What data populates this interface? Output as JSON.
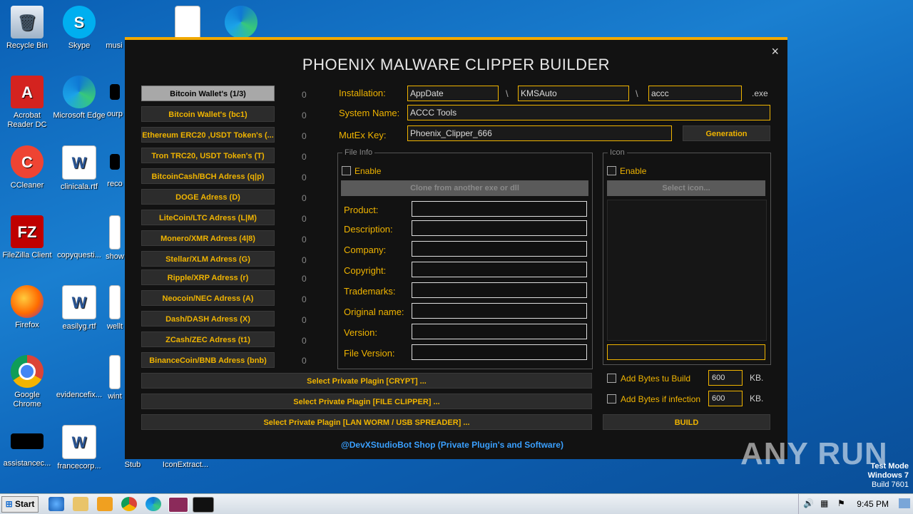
{
  "desktop": {
    "icons": [
      {
        "label": "Recycle Bin",
        "icon": "recycle-bin-icon"
      },
      {
        "label": "Skype",
        "icon": "skype-icon"
      },
      {
        "label": "musi",
        "icon": "blank-icon"
      },
      {
        "label": "Acrobat Reader DC",
        "icon": "acrobat-icon"
      },
      {
        "label": "Microsoft Edge",
        "icon": "edge-icon"
      },
      {
        "label": "ourp",
        "icon": "blank-icon"
      },
      {
        "label": "CCleaner",
        "icon": "ccleaner-icon"
      },
      {
        "label": "clinicala.rtf",
        "icon": "word-doc-icon"
      },
      {
        "label": "reco",
        "icon": "blank-icon"
      },
      {
        "label": "FileZilla Client",
        "icon": "filezilla-icon"
      },
      {
        "label": "copyquesti...",
        "icon": "blank-icon"
      },
      {
        "label": "show",
        "icon": "word-doc-icon"
      },
      {
        "label": "Firefox",
        "icon": "firefox-icon"
      },
      {
        "label": "easilyg.rtf",
        "icon": "word-doc-icon"
      },
      {
        "label": "wellt",
        "icon": "word-doc-icon"
      },
      {
        "label": "Google Chrome",
        "icon": "chrome-icon"
      },
      {
        "label": "evidencefix...",
        "icon": "blank-icon"
      },
      {
        "label": "wint",
        "icon": "word-doc-icon"
      },
      {
        "label": "assistancec...",
        "icon": "black-icon"
      },
      {
        "label": "francecorp...",
        "icon": "word-doc-icon"
      },
      {
        "label": "Stub",
        "icon": "stub-icon"
      },
      {
        "label": "IconExtract...",
        "icon": "blank-icon"
      }
    ],
    "watermark": "ANY RUN",
    "test_mode": {
      "line1": "Test Mode",
      "line2": "Windows 7",
      "line3": "Build 7601"
    }
  },
  "window": {
    "title": "PHOENIX MALWARE CLIPPER BUILDER",
    "close": "×",
    "wallets": [
      {
        "label": "Bitcoin Wallet's (1/3)",
        "count": "0"
      },
      {
        "label": "Bitcoin Wallet's (bc1)",
        "count": "0"
      },
      {
        "label": "Ethereum ERC20 ,USDT Token's (...",
        "count": "0"
      },
      {
        "label": "Tron TRC20, USDT Token's (T)",
        "count": "0"
      },
      {
        "label": "BitcoinCash/BCH Adress (q|p)",
        "count": "0"
      },
      {
        "label": "DOGE Adress (D)",
        "count": "0"
      },
      {
        "label": "LiteCoin/LTC Adress (L|M)",
        "count": "0"
      },
      {
        "label": "Monero/XMR Adress (4|8)",
        "count": "0"
      },
      {
        "label": "Stellar/XLM Adress (G)",
        "count": "0"
      },
      {
        "label": "Ripple/XRP Adress (r)",
        "count": "0"
      },
      {
        "label": "Neocoin/NEC Adress (A)",
        "count": "0"
      },
      {
        "label": "Dash/DASH Adress (X)",
        "count": "0"
      },
      {
        "label": "ZCash/ZEC Adress (t1)",
        "count": "0"
      },
      {
        "label": "BinanceCoin/BNB Adress (bnb)",
        "count": "0"
      }
    ],
    "installation": {
      "label": "Installation:",
      "dir1": "AppDate",
      "sep": "\\",
      "dir2": "KMSAuto",
      "file": "accc",
      "ext": ".exe"
    },
    "system_name": {
      "label": "System Name:",
      "value": "ACCC Tools"
    },
    "mutex": {
      "label": "MutEx Key:",
      "value": "Phoenix_Clipper_666",
      "button": "Generation"
    },
    "file_info": {
      "title": "File Info",
      "enable": "Enable",
      "clone_button": "Clone from another exe or dll",
      "fields": [
        "Product:",
        "Description:",
        "Company:",
        "Copyright:",
        "Trademarks:",
        "Original name:",
        "Version:",
        "File Version:"
      ]
    },
    "icon_group": {
      "title": "Icon",
      "enable": "Enable",
      "select_button": "Select icon..."
    },
    "plugins": [
      "Select Private Plagin [CRYPT] ...",
      "Select Private Plagin [FILE CLIPPER] ...",
      "Select Private Plagin [LAN WORM / USB SPREADER] ..."
    ],
    "add_bytes_build": {
      "label": "Add Bytes tu Build",
      "value": "600",
      "unit": "KB."
    },
    "add_bytes_infection": {
      "label": "Add Bytes if infection",
      "value": "600",
      "unit": "KB."
    },
    "build_button": "BUILD",
    "footer": "@DevXStudioBot Shop (Private Plugin's and Software)"
  },
  "taskbar": {
    "start": "Start",
    "clock": "9:45 PM"
  }
}
